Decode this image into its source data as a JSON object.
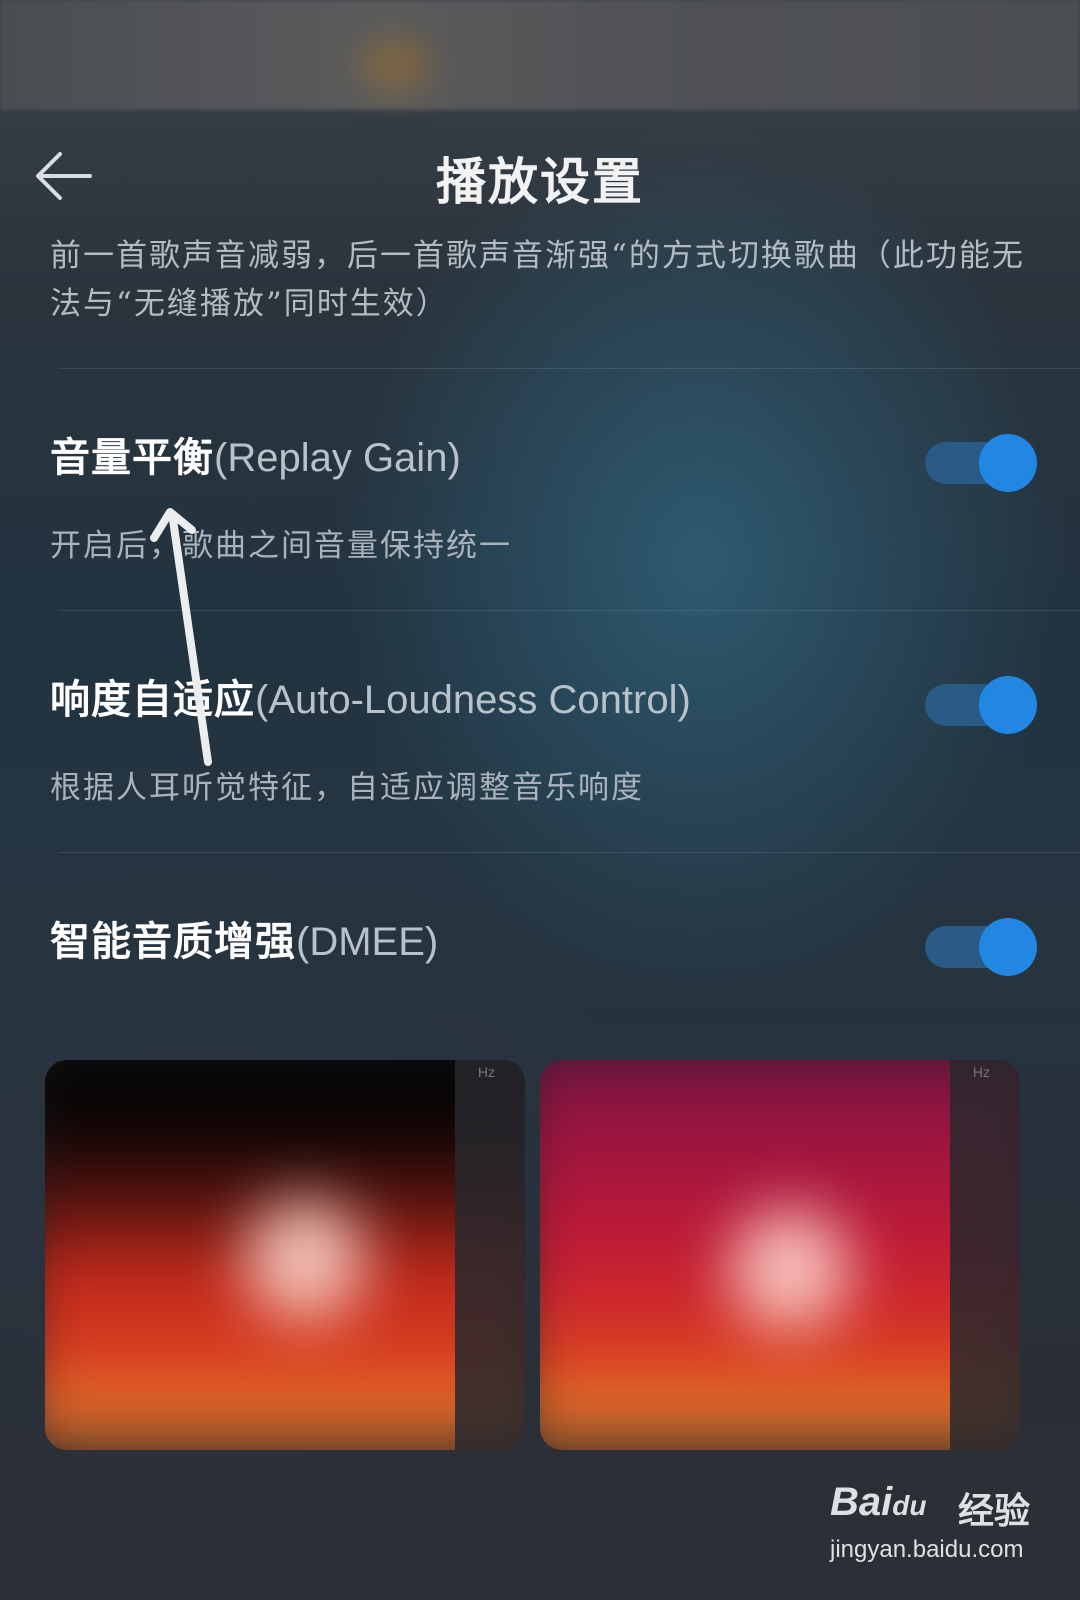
{
  "header": {
    "title": "播放设置",
    "back_icon": "arrow-left-icon"
  },
  "previous_item": {
    "description": "前一首歌声音减弱，后一首歌声音渐强“的方式切换歌曲（此功能无法与“无缝播放”同时生效）"
  },
  "settings": [
    {
      "title_cn": "音量平衡",
      "title_en": "(Replay Gain)",
      "description": "开启后，歌曲之间音量保持统一",
      "enabled": true
    },
    {
      "title_cn": "响度自适应",
      "title_en": "(Auto-Loudness Control)",
      "description": "根据人耳听觉特征，自适应调整音乐响度",
      "enabled": true
    },
    {
      "title_cn": "智能音质增强",
      "title_en": "(DMEE)",
      "enabled": true
    }
  ],
  "spectrograms": [
    {
      "unit_label": "Hz"
    },
    {
      "unit_label": "Hz"
    }
  ],
  "colors": {
    "toggle_on_knob": "#2287e3",
    "toggle_on_track": "#2a5b86"
  },
  "watermark": {
    "brand": "Bai",
    "brand_mark": "du",
    "brand_cn": "经验",
    "url": "jingyan.baidu.com"
  }
}
